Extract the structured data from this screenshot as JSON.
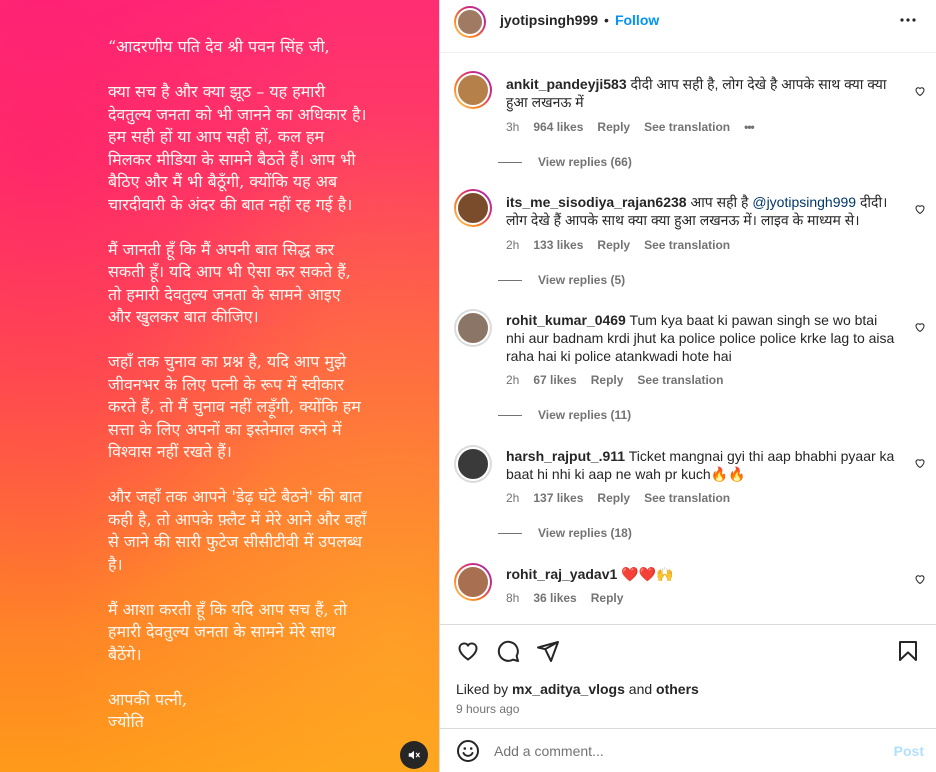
{
  "post": {
    "caption": "“आदरणीय पति देव श्री पवन सिंह जी,\n\nक्या सच है और क्या झूठ – यह हमारी देवतुल्य जनता को भी जानने का अधिकार है। हम सही हों या आप सही हों, कल हम मिलकर मीडिया के सामने बैठते हैं। आप भी बैठिए और मैं भी बैठूँगी, क्योंकि यह अब चारदीवारी के अंदर की बात नहीं रह गई है।\n\nमैं जानती हूँ कि मैं अपनी बात सिद्ध कर सकती हूँ। यदि आप भी ऐसा कर सकते हैं, तो हमारी देवतुल्य जनता के सामने आइए और खुलकर बात कीजिए।\n\nजहाँ तक चुनाव का प्रश्न है, यदि आप मुझे जीवनभर के लिए पत्नी के रूप में स्वीकार करते हैं, तो मैं चुनाव नहीं लड़ूँगी, क्योंकि हम सत्ता के लिए अपनों का इस्तेमाल करने में विश्वास नहीं रखते हैं।\n\nऔर जहाँ तक आपने 'डेढ़ घंटे बैठने' की बात कही है, तो आपके फ़्लैट में मेरे आने और वहाँ से जाने की सारी फुटेज सीसीटीवी में उपलब्ध है।\n\nमैं आशा करती हूँ कि यदि आप सच हैं, तो हमारी देवतुल्य जनता के सामने मेरे साथ बैठेंगे।\n\nआपकी पत्नी,\nज्योति"
  },
  "header": {
    "username": "jyotipsingh999",
    "separator": "•",
    "follow_label": "Follow"
  },
  "comments": [
    {
      "username": "ankit_pandeyji583",
      "text": "दीदी आप सही है, लोग देखे है आपके साथ क्या क्या हुआ लखनऊ में",
      "time": "3h",
      "likes": "964 likes",
      "reply": "Reply",
      "translate": "See translation",
      "more": "•••",
      "view_replies": "View replies (66)"
    },
    {
      "username": "its_me_sisodiya_rajan6238",
      "text_before": "आप सही है",
      "mention": "@jyotipsingh999",
      "text_after": "दीदी। लोग देखे हैं आपके साथ क्या क्या हुआ लखनऊ में। लाइव के माध्यम से।",
      "time": "2h",
      "likes": "133 likes",
      "reply": "Reply",
      "translate": "See translation",
      "view_replies": "View replies (5)"
    },
    {
      "username": "rohit_kumar_0469",
      "text": "Tum kya baat ki pawan singh se wo btai nhi aur badnam krdi jhut ka police police police krke lag to aisa raha hai ki police atankwadi hote hai",
      "time": "2h",
      "likes": "67 likes",
      "reply": "Reply",
      "translate": "See translation",
      "view_replies": "View replies (11)"
    },
    {
      "username": "harsh_rajput_.911",
      "text": "Ticket mangnai gyi thi aap bhabhi pyaar ka baat hi nhi ki aap ne wah pr kuch🔥🔥",
      "time": "2h",
      "likes": "137 likes",
      "reply": "Reply",
      "translate": "See translation",
      "view_replies": "View replies (18)"
    },
    {
      "username": "rohit_raj_yadav1",
      "text": "❤️❤️🙌",
      "time": "8h",
      "likes": "36 likes",
      "reply": "Reply"
    }
  ],
  "actions": {
    "liked_prefix": "Liked by",
    "liked_user": "mx_aditya_vlogs",
    "liked_and": "and",
    "liked_others": "others",
    "time_ago": "9 hours ago"
  },
  "add_comment": {
    "placeholder": "Add a comment...",
    "post_label": "Post"
  }
}
